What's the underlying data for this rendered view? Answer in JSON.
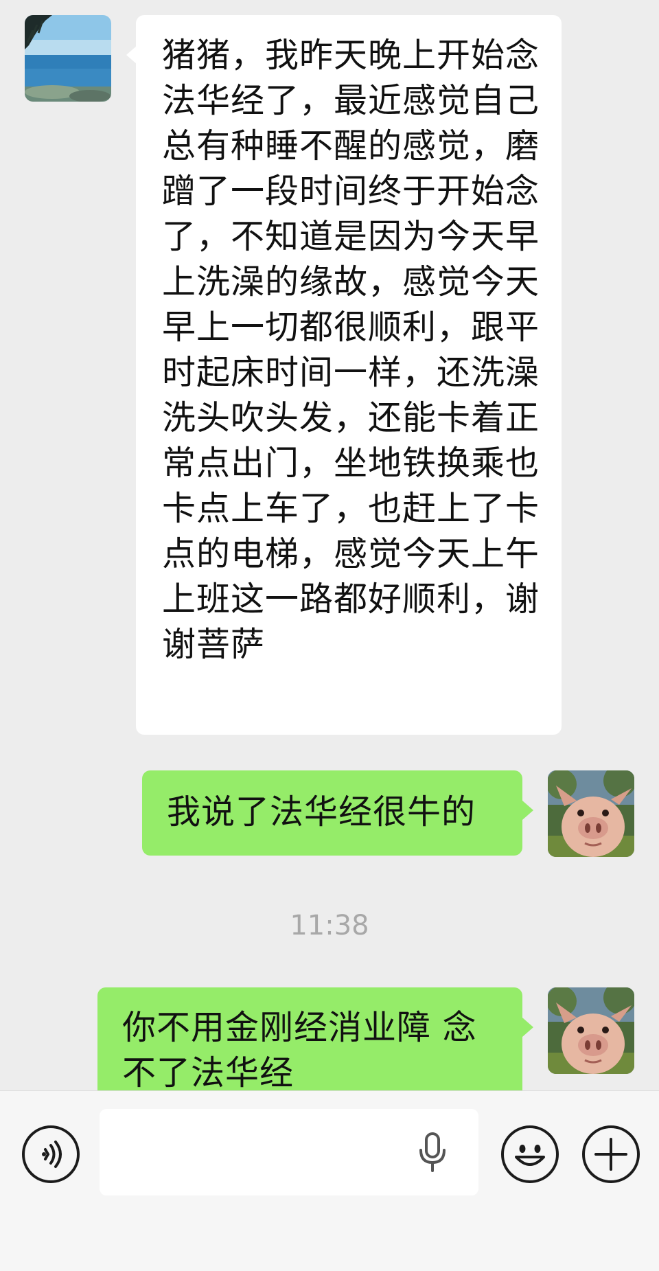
{
  "messages": [
    {
      "side": "left",
      "avatar": "sea-avatar",
      "text": "猪猪，我昨天晚上开始念法华经了，最近感觉自己总有种睡不醒的感觉，磨蹭了一段时间终于开始念了，不知道是因为今天早上洗澡的缘故，感觉今天早上一切都很顺利，跟平时起床时间一样，还洗澡洗头吹头发，还能卡着正常点出门，坐地铁换乘也卡点上车了，也赶上了卡点的电梯，感觉今天上午上班这一路都好顺利，谢谢菩萨"
    },
    {
      "side": "right",
      "avatar": "pig-avatar",
      "text": "我说了法华经很牛的"
    },
    {
      "side": "right",
      "avatar": "pig-avatar",
      "text": "你不用金刚经消业障 念不了法华经"
    }
  ],
  "timestamp": "11:38",
  "input_bar": {
    "voice_icon": "voice-icon",
    "mic_icon": "microphone-icon",
    "emoji_icon": "emoji-icon",
    "plus_icon": "plus-icon"
  },
  "colors": {
    "background": "#ededed",
    "incoming_bubble": "#ffffff",
    "outgoing_bubble": "#95ec69",
    "timestamp": "#a8a8a8"
  }
}
